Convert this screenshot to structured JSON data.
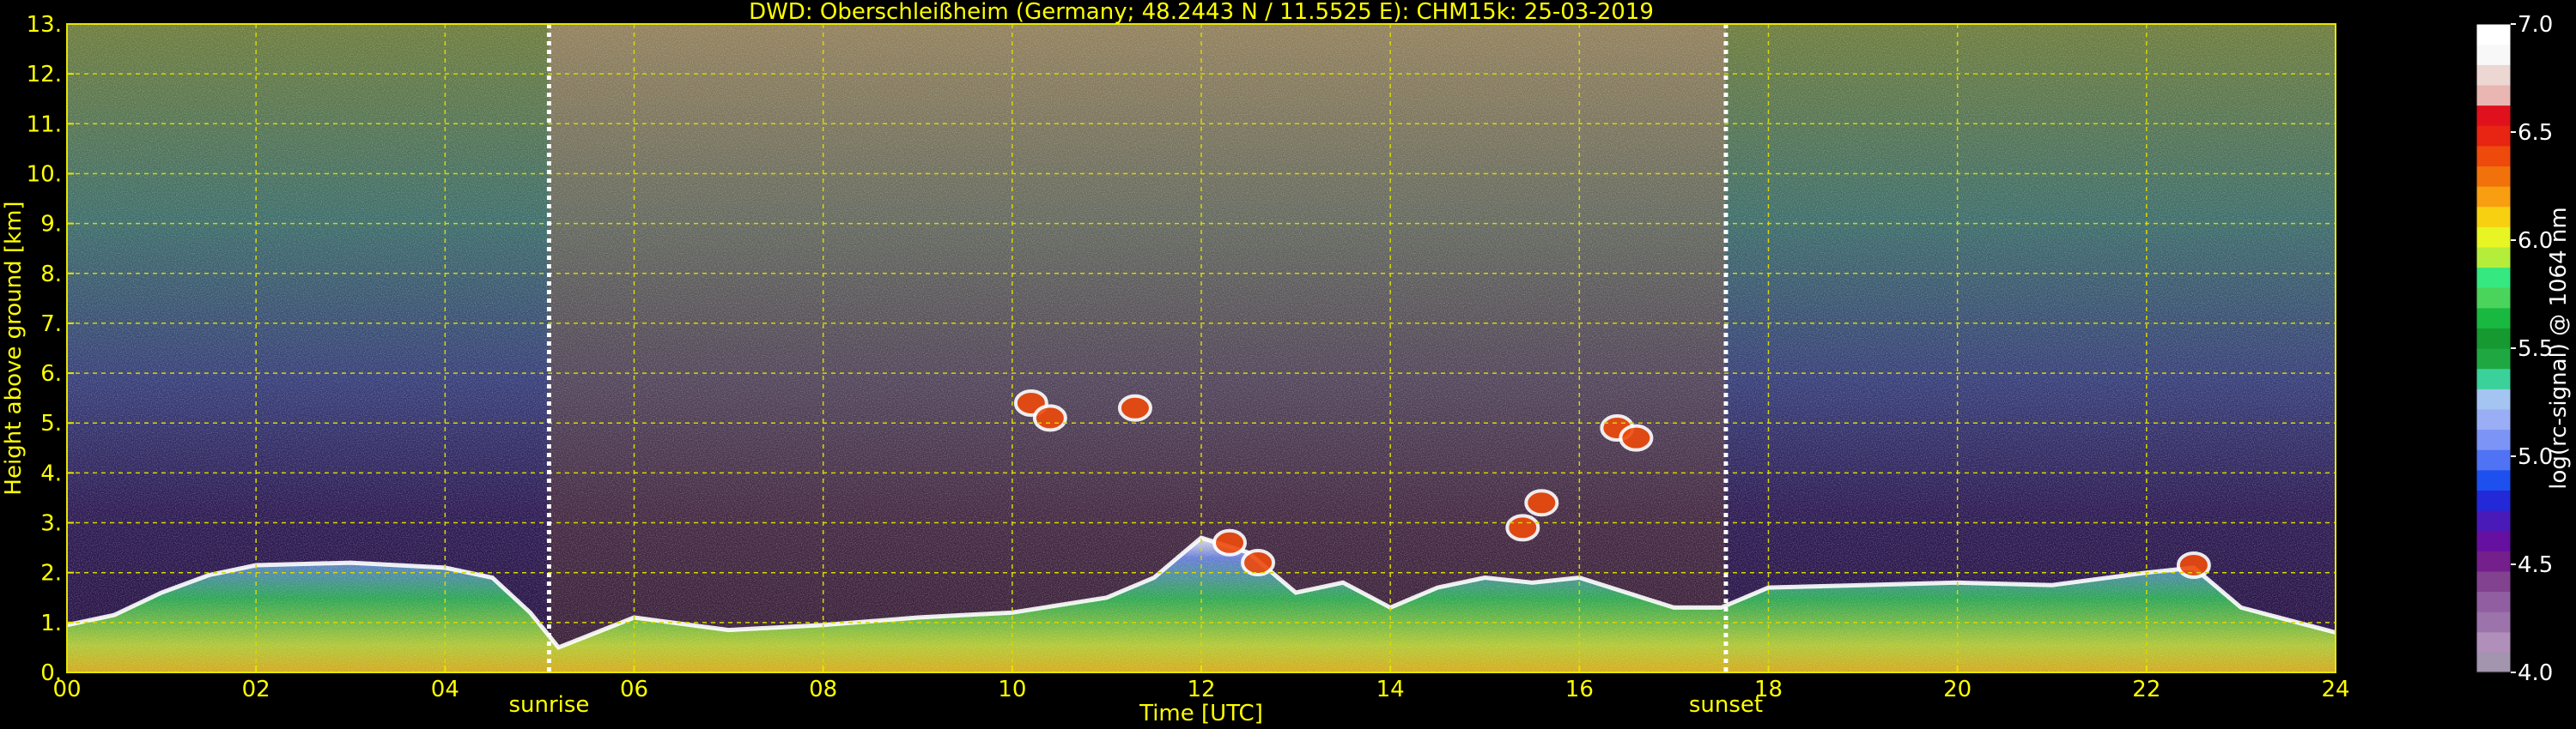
{
  "chart_data": {
    "type": "heatmap",
    "title": "DWD: Oberschleißheim (Germany; 48.2443 N / 11.5525 E):    CHM15k: 25-03-2019",
    "xlabel": "Time [UTC]",
    "ylabel": "Height above ground [km]",
    "xlim": [
      0,
      24
    ],
    "ylim": [
      0,
      13
    ],
    "x_ticks": [
      {
        "value": 0,
        "label": "00"
      },
      {
        "value": 2,
        "label": "02"
      },
      {
        "value": 4,
        "label": "04"
      },
      {
        "value": 6,
        "label": "06"
      },
      {
        "value": 8,
        "label": "08"
      },
      {
        "value": 10,
        "label": "10"
      },
      {
        "value": 12,
        "label": "12"
      },
      {
        "value": 14,
        "label": "14"
      },
      {
        "value": 16,
        "label": "16"
      },
      {
        "value": 18,
        "label": "18"
      },
      {
        "value": 20,
        "label": "20"
      },
      {
        "value": 22,
        "label": "22"
      },
      {
        "value": 24,
        "label": "24"
      }
    ],
    "y_ticks": [
      {
        "value": 0,
        "label": "0."
      },
      {
        "value": 1,
        "label": "1."
      },
      {
        "value": 2,
        "label": "2."
      },
      {
        "value": 3,
        "label": "3."
      },
      {
        "value": 4,
        "label": "4."
      },
      {
        "value": 5,
        "label": "5."
      },
      {
        "value": 6,
        "label": "6."
      },
      {
        "value": 7,
        "label": "7."
      },
      {
        "value": 8,
        "label": "8."
      },
      {
        "value": 9,
        "label": "9."
      },
      {
        "value": 10,
        "label": "10."
      },
      {
        "value": 11,
        "label": "11."
      },
      {
        "value": 12,
        "label": "12."
      },
      {
        "value": 13,
        "label": "13."
      }
    ],
    "grid": true,
    "annotations": [
      {
        "label": "sunrise",
        "time": 5.1
      },
      {
        "label": "sunset",
        "time": 17.55
      }
    ],
    "colorbar": {
      "label": "log(rc-signal) @ 1064 nm",
      "range": [
        4.0,
        7.0
      ],
      "ticks": [
        {
          "value": 4.0,
          "label": "4.0"
        },
        {
          "value": 4.5,
          "label": "4.5"
        },
        {
          "value": 5.0,
          "label": "5.0"
        },
        {
          "value": 5.5,
          "label": "5.5"
        },
        {
          "value": 6.0,
          "label": "6.0"
        },
        {
          "value": 6.5,
          "label": "6.5"
        },
        {
          "value": 7.0,
          "label": "7.0"
        }
      ],
      "colors": [
        "#a295ad",
        "#b08fbb",
        "#9c73ab",
        "#915ea2",
        "#82428f",
        "#741f8c",
        "#6510a0",
        "#4a1ab8",
        "#2328d8",
        "#1d50ee",
        "#5072f5",
        "#7b94f6",
        "#99aef4",
        "#a4c4f1",
        "#3bd19a",
        "#1fa842",
        "#169930",
        "#19b840",
        "#4bd45b",
        "#35e880",
        "#b5ee3a",
        "#e6f523",
        "#f7d011",
        "#f89e10",
        "#f1720a",
        "#ee4a0c",
        "#e82412",
        "#e0111c",
        "#e9b6b2",
        "#edd7d3",
        "#f8f8f8",
        "#ffffff"
      ]
    },
    "layers": [
      {
        "name": "boundary layer",
        "points": [
          [
            0.0,
            0.95
          ],
          [
            0.5,
            1.15
          ],
          [
            1.0,
            1.6
          ],
          [
            1.5,
            1.95
          ],
          [
            2.0,
            2.15
          ],
          [
            3.0,
            2.2
          ],
          [
            4.0,
            2.1
          ],
          [
            4.5,
            1.9
          ],
          [
            4.9,
            1.2
          ],
          [
            5.2,
            0.5
          ],
          [
            5.6,
            0.8
          ],
          [
            6.0,
            1.1
          ],
          [
            7.0,
            0.85
          ],
          [
            8.0,
            0.95
          ],
          [
            9.0,
            1.1
          ],
          [
            10.0,
            1.2
          ],
          [
            11.0,
            1.5
          ],
          [
            11.5,
            1.9
          ],
          [
            12.0,
            2.7
          ],
          [
            12.5,
            2.4
          ],
          [
            13.0,
            1.6
          ],
          [
            13.5,
            1.8
          ],
          [
            14.0,
            1.3
          ],
          [
            14.5,
            1.7
          ],
          [
            15.0,
            1.9
          ],
          [
            15.5,
            1.8
          ],
          [
            16.0,
            1.9
          ],
          [
            16.5,
            1.6
          ],
          [
            17.0,
            1.3
          ],
          [
            17.5,
            1.3
          ],
          [
            18.0,
            1.7
          ],
          [
            19.0,
            1.75
          ],
          [
            20.0,
            1.8
          ],
          [
            21.0,
            1.75
          ],
          [
            22.0,
            2.0
          ],
          [
            22.5,
            2.1
          ],
          [
            23.0,
            1.3
          ],
          [
            24.0,
            0.8
          ]
        ]
      },
      {
        "name": "cloud",
        "points": [
          [
            10.2,
            5.4
          ],
          [
            10.4,
            5.1
          ],
          [
            11.3,
            5.3
          ],
          [
            12.3,
            2.6
          ],
          [
            12.6,
            2.2
          ],
          [
            15.4,
            2.9
          ],
          [
            15.6,
            3.4
          ],
          [
            16.4,
            4.9
          ],
          [
            16.6,
            4.7
          ],
          [
            22.5,
            2.15
          ]
        ]
      }
    ]
  }
}
